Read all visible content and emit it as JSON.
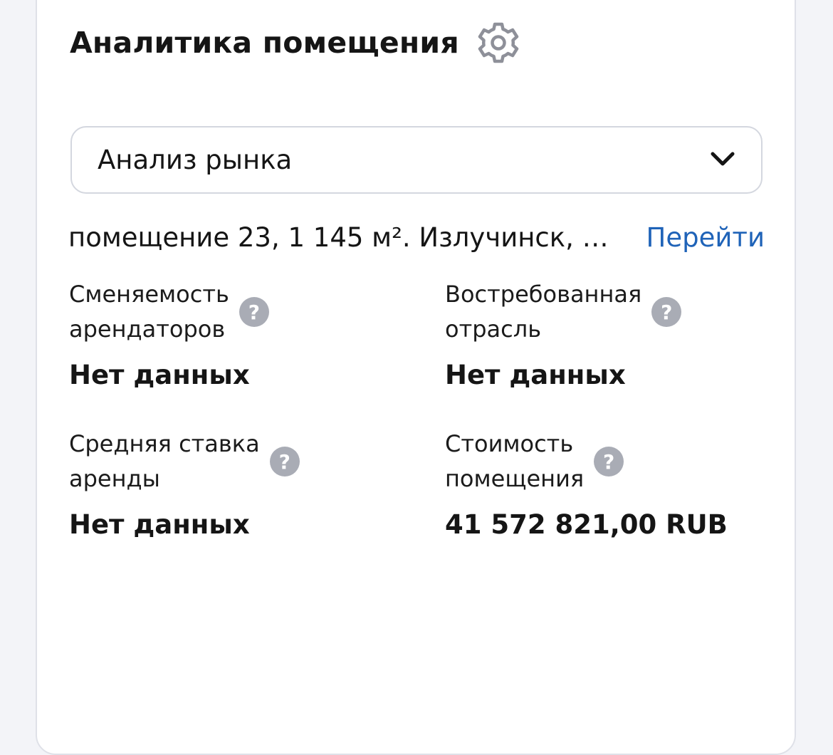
{
  "header": {
    "title": "Аналитика помещения",
    "settings_icon": "gear-icon"
  },
  "selector": {
    "selected_value": "Анализ рынка",
    "icon": "chevron-down-icon"
  },
  "listing": {
    "address": "помещение 23, 1 145 м². Излучинск, …",
    "goto_label": "Перейти",
    "link_color": "#1f63b8"
  },
  "metrics": [
    {
      "label_line1": "Сменяемость",
      "label_line2": "арендаторов",
      "value": "Нет данных",
      "icon": "question-circle-icon"
    },
    {
      "label_line1": "Востребованная",
      "label_line2": "отрасль",
      "value": "Нет данных",
      "icon": "question-circle-icon"
    },
    {
      "label_line1": "Средняя ставка",
      "label_line2": "аренды",
      "value": "Нет данных",
      "icon": "question-circle-icon"
    },
    {
      "label_line1": "Стоимость",
      "label_line2": "помещения",
      "value": "41 572 821,00 RUB",
      "icon": "question-circle-icon"
    }
  ],
  "help_glyph": "?",
  "colors": {
    "help_icon_bg": "#a9acb5",
    "text": "#151515",
    "border": "#d4d7df"
  }
}
